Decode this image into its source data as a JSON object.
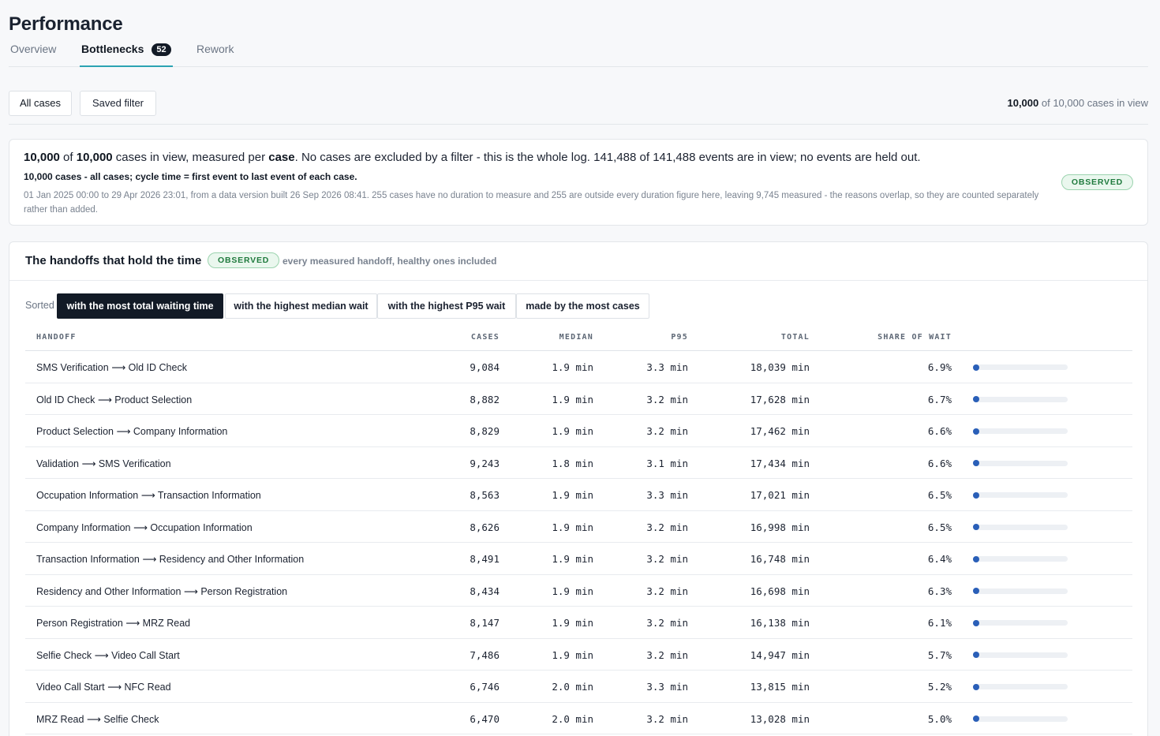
{
  "page": {
    "title": "Performance"
  },
  "tabs": [
    {
      "label": "Overview"
    },
    {
      "label": "Bottlenecks",
      "badge": "52"
    },
    {
      "label": "Rework"
    }
  ],
  "filters": {
    "all_cases": "All cases",
    "saved_filter": "Saved filter",
    "in_view_count": "10,000",
    "in_view_rest": " of 10,000 cases in view"
  },
  "summary": {
    "cases_in_view": "10,000",
    "of_label": " of ",
    "cases_total": "10,000",
    "measured_per_prefix": " cases in view, measured per ",
    "unit": "case",
    "rest": ". No cases are excluded by a filter - this is the whole log. 141,488 of 141,488 events are in view; no events are held out.",
    "definition": "10,000 cases - all cases; cycle time = first event to last event of each case.",
    "detail": "01 Jan 2025 00:00 to 29 Apr 2026 23:01, from a data version built 26 Sep 2026 08:41. 255 cases have no duration to measure and 255 are outside every duration figure here, leaving 9,745 measured - the reasons overlap, so they are counted separately rather than added.",
    "badge": "OBSERVED"
  },
  "handoffs": {
    "title": "The handoffs that hold the time",
    "badge": "OBSERVED",
    "subtitle": "every measured handoff, healthy ones included",
    "sorted_label": "Sorted",
    "sort_options": [
      "with the most total waiting time",
      "with the highest median wait",
      "with the highest P95 wait",
      "made by the most cases"
    ],
    "columns": {
      "handoff": "HANDOFF",
      "cases": "CASES",
      "median": "MEDIAN",
      "p95": "P95",
      "total": "TOTAL",
      "share": "SHARE OF WAIT"
    },
    "rows": [
      {
        "from": "SMS Verification",
        "arrow": "⟶",
        "to": "Old ID Check",
        "cases": "9,084",
        "median": "1.9 min",
        "p95": "3.3 min",
        "total": "18,039 min",
        "share": "6.9%",
        "share_value": 6.9
      },
      {
        "from": "Old ID Check",
        "arrow": "⟶",
        "to": "Product Selection",
        "cases": "8,882",
        "median": "1.9 min",
        "p95": "3.2 min",
        "total": "17,628 min",
        "share": "6.7%",
        "share_value": 6.7
      },
      {
        "from": "Product Selection",
        "arrow": "⟶",
        "to": "Company Information",
        "cases": "8,829",
        "median": "1.9 min",
        "p95": "3.2 min",
        "total": "17,462 min",
        "share": "6.6%",
        "share_value": 6.6
      },
      {
        "from": "Validation",
        "arrow": "⟶",
        "to": "SMS Verification",
        "cases": "9,243",
        "median": "1.8 min",
        "p95": "3.1 min",
        "total": "17,434 min",
        "share": "6.6%",
        "share_value": 6.6
      },
      {
        "from": "Occupation Information",
        "arrow": "⟶",
        "to": "Transaction Information",
        "cases": "8,563",
        "median": "1.9 min",
        "p95": "3.3 min",
        "total": "17,021 min",
        "share": "6.5%",
        "share_value": 6.5
      },
      {
        "from": "Company Information",
        "arrow": "⟶",
        "to": "Occupation Information",
        "cases": "8,626",
        "median": "1.9 min",
        "p95": "3.2 min",
        "total": "16,998 min",
        "share": "6.5%",
        "share_value": 6.5
      },
      {
        "from": "Transaction Information",
        "arrow": "⟶",
        "to": "Residency and Other Information",
        "cases": "8,491",
        "median": "1.9 min",
        "p95": "3.2 min",
        "total": "16,748 min",
        "share": "6.4%",
        "share_value": 6.4
      },
      {
        "from": "Residency and Other Information",
        "arrow": "⟶",
        "to": "Person Registration",
        "cases": "8,434",
        "median": "1.9 min",
        "p95": "3.2 min",
        "total": "16,698 min",
        "share": "6.3%",
        "share_value": 6.3
      },
      {
        "from": "Person Registration",
        "arrow": "⟶",
        "to": "MRZ Read",
        "cases": "8,147",
        "median": "1.9 min",
        "p95": "3.2 min",
        "total": "16,138 min",
        "share": "6.1%",
        "share_value": 6.1
      },
      {
        "from": "Selfie Check",
        "arrow": "⟶",
        "to": "Video Call Start",
        "cases": "7,486",
        "median": "1.9 min",
        "p95": "3.2 min",
        "total": "14,947 min",
        "share": "5.7%",
        "share_value": 5.7
      },
      {
        "from": "Video Call Start",
        "arrow": "⟶",
        "to": "NFC Read",
        "cases": "6,746",
        "median": "2.0 min",
        "p95": "3.3 min",
        "total": "13,815 min",
        "share": "5.2%",
        "share_value": 5.2
      },
      {
        "from": "MRZ Read",
        "arrow": "⟶",
        "to": "Selfie Check",
        "cases": "6,470",
        "median": "2.0 min",
        "p95": "3.2 min",
        "total": "13,028 min",
        "share": "5.0%",
        "share_value": 5.0
      }
    ]
  },
  "colors": {
    "accent": "#2ba3b3",
    "dark": "#121a26",
    "bar_dot": "#2a5fb8",
    "observed_green": "#1f7a3d"
  }
}
